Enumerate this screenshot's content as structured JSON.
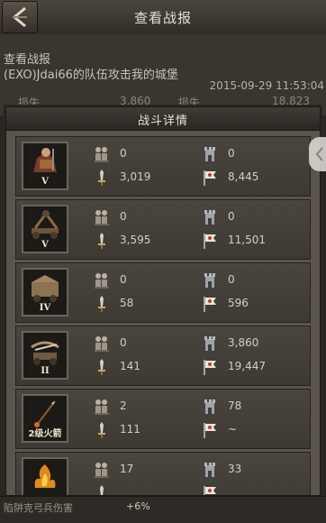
{
  "header": {
    "title": "查看战报"
  },
  "report": {
    "heading": "查看战报",
    "description": "(EXO)Jdai66的队伍攻击我的城堡",
    "datetime": "2015-09-29  11:53:04",
    "left_loss_label": "损失",
    "left_loss_value": "3,860",
    "right_loss_label": "损失",
    "right_loss_value": "18,823"
  },
  "panel": {
    "title": "战斗详情",
    "rows": [
      {
        "rank": "V",
        "unit": "cavalry",
        "c1_top": "0",
        "c1_bottom": "3,019",
        "c2_top": "0",
        "c2_bottom": "8,445"
      },
      {
        "rank": "V",
        "unit": "siege-catapult",
        "c1_top": "0",
        "c1_bottom": "3,595",
        "c2_top": "0",
        "c2_bottom": "11,501"
      },
      {
        "rank": "IV",
        "unit": "siege-engine",
        "c1_top": "0",
        "c1_bottom": "58",
        "c2_top": "0",
        "c2_bottom": "596"
      },
      {
        "rank": "II",
        "unit": "ballista",
        "c1_top": "0",
        "c1_bottom": "141",
        "c2_top": "3,860",
        "c2_bottom": "19,447"
      },
      {
        "rank": "2级火箭",
        "unit": "fire-arrow",
        "c1_top": "2",
        "c1_bottom": "111",
        "c2_top": "78",
        "c2_bottom": "~"
      },
      {
        "rank": "",
        "unit": "fire-trap",
        "c1_top": "17",
        "c1_bottom": "",
        "c2_top": "33",
        "c2_bottom": ""
      }
    ]
  },
  "bottom": {
    "label": "陷阱克弓兵伤害",
    "value": "+6%"
  },
  "colors": {
    "panel_bg": "#5a544b",
    "row_bg": "#4a453e",
    "header_bg": "#3f3b35",
    "text": "#d6cfbf"
  }
}
